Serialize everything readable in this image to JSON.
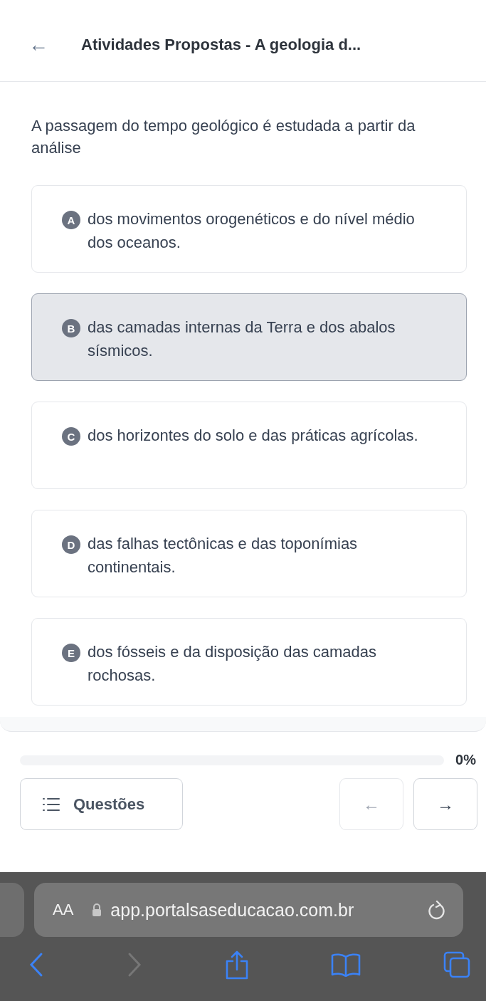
{
  "header": {
    "back": "←",
    "title": "Atividades Propostas - A geologia d..."
  },
  "question": {
    "text": "A passagem do tempo geológico é estudada a partir da análise",
    "options": [
      {
        "letter": "A",
        "text": "dos movimentos orogenéticos e do nível médio dos oceanos.",
        "selected": false
      },
      {
        "letter": "B",
        "text": "das camadas internas da Terra e dos abalos sísmicos.",
        "selected": true
      },
      {
        "letter": "C",
        "text": "dos horizontes do solo e das práticas agrícolas.",
        "selected": false
      },
      {
        "letter": "D",
        "text": "das falhas tectônicas e das toponímias continentais.",
        "selected": false
      },
      {
        "letter": "E",
        "text": "dos fósseis e da disposição das camadas rochosas.",
        "selected": false
      }
    ]
  },
  "progress": {
    "level": 0,
    "reading": "0%"
  },
  "nav": {
    "questions_button": "Questões",
    "prev": "←",
    "next": "→",
    "prev_disabled": true
  },
  "browser": {
    "text_size": "AA",
    "url": "app.portalsaseducacao.com.br"
  }
}
